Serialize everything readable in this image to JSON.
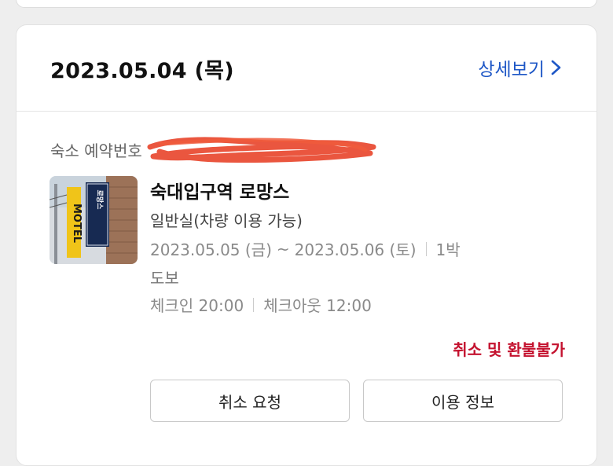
{
  "booking": {
    "date": "2023.05.04 (목)",
    "detail_link": "상세보기",
    "reservation_label": "숙소 예약번호",
    "hotel_name": "숙대입구역 로망스",
    "room_type": "일반실(차량 이용 가능)",
    "checkin_date": "2023.05.05 (금)",
    "range_separator": "~",
    "checkout_date": "2023.05.06 (토)",
    "nights": "1박",
    "access": "도보",
    "checkin_time": "체크인 20:00",
    "checkout_time": "체크아웃 12:00",
    "refund_policy": "취소 및 환불불가"
  },
  "buttons": {
    "cancel_request": "취소 요청",
    "usage_info": "이용 정보"
  },
  "thumbnail": {
    "sign_text": "로망스",
    "vertical_sign_text": "MOTEL"
  },
  "colors": {
    "link": "#1e57c6",
    "refund_warning": "#c4122f",
    "redaction": "#e8442a"
  },
  "icons": {
    "detail_chevron": "chevron-right-icon"
  }
}
